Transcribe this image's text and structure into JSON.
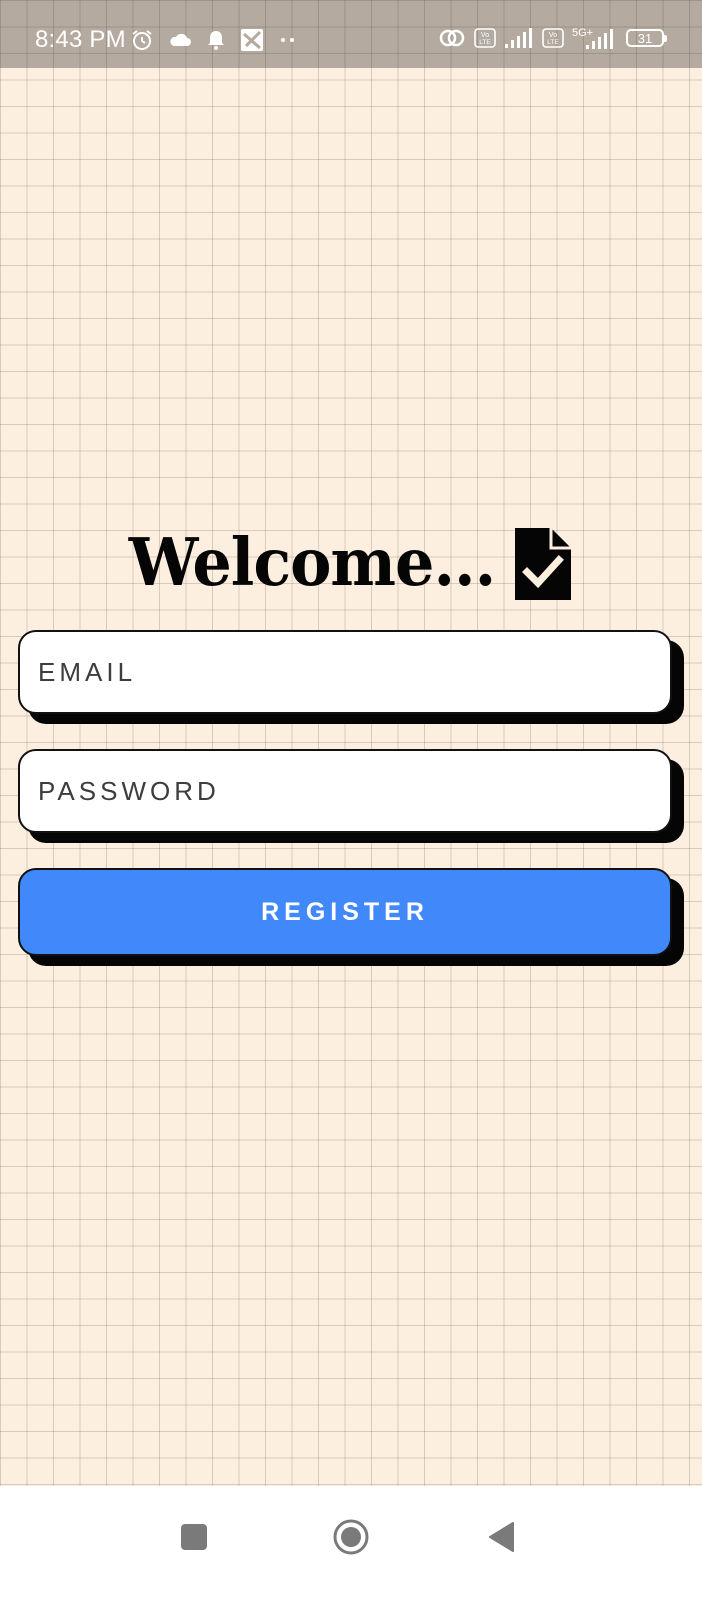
{
  "status_bar": {
    "time": "8:43 PM",
    "left_icons": [
      "alarm-icon",
      "cloud-icon",
      "notification-bell-icon",
      "app-icon",
      "more-dots-icon"
    ],
    "right_icons": [
      "link-icon",
      "volte-icon",
      "signal-icon",
      "volte-icon",
      "5g-signal-icon",
      "battery-icon"
    ],
    "volte_label": "Vo\nLTE",
    "network_label": "5G+",
    "battery_level": "31"
  },
  "welcome": {
    "title": "Welcome...",
    "icon": "document-check-icon"
  },
  "form": {
    "email_placeholder": "EMAIL",
    "password_placeholder": "PASSWORD",
    "register_label": "REGISTER"
  },
  "nav_bar": {
    "icons": [
      "recents-square-icon",
      "home-circle-icon",
      "back-triangle-icon"
    ]
  },
  "colors": {
    "background": "#fdefdf",
    "status_bar": "#b4aa9f",
    "button": "#4188fa",
    "shadow": "#050505"
  }
}
